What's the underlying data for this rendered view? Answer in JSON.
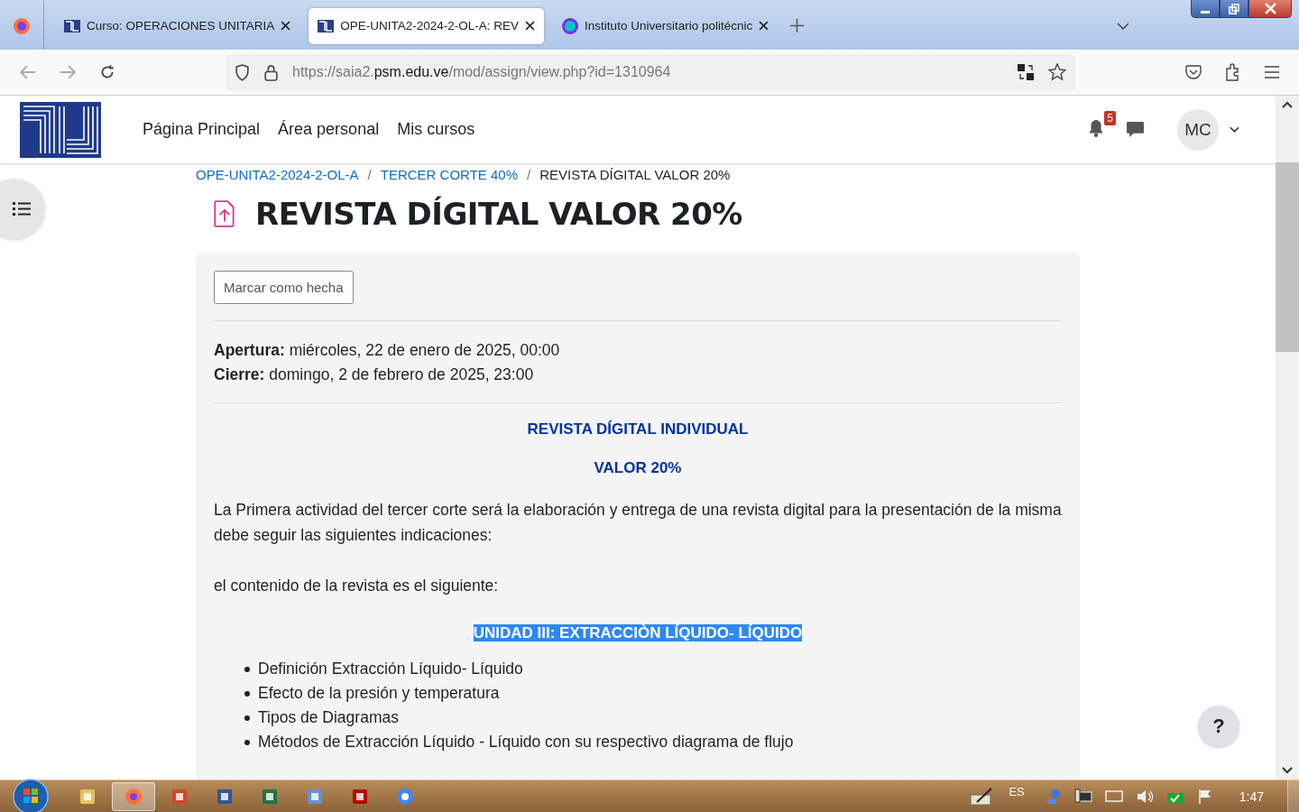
{
  "browser_tabs": [
    {
      "title": "Curso: OPERACIONES UNITARIA",
      "kind": "site",
      "selected": false
    },
    {
      "title": "OPE-UNITA2-2024-2-OL-A: REV",
      "kind": "site",
      "selected": true
    },
    {
      "title": "Instituto Universitario politécnic",
      "kind": "canva",
      "selected": false
    }
  ],
  "address": {
    "prefix": "https://saia2.",
    "host": "psm.edu.ve",
    "path": "/mod/assign/view.php?id=1310964"
  },
  "nav_links": [
    "Página Principal",
    "Área personal",
    "Mis cursos"
  ],
  "notifications": "5",
  "avatar": "MC",
  "breadcrumb": [
    {
      "kind": "link",
      "text": "OPE-UNITA2-2024-2-OL-A"
    },
    {
      "kind": "separator",
      "text": "/"
    },
    {
      "kind": "link",
      "text": "TERCER CORTE 40%"
    },
    {
      "kind": "separator",
      "text": "/"
    },
    {
      "kind": "current",
      "text": "REVISTA DÍGITAL VALOR 20%"
    }
  ],
  "title": "REVISTA DÍGITAL VALOR 20%",
  "done_button": "Marcar como hecha",
  "dates": [
    {
      "label": "Apertura:",
      "value": "miércoles, 22 de enero de 2025, 00:00"
    },
    {
      "label": "Cierre:",
      "value": "domingo, 2 de febrero de 2025, 23:00"
    }
  ],
  "content": [
    {
      "kind": "heading",
      "text": "REVISTA DÍGITAL INDIVIDUAL"
    },
    {
      "kind": "heading",
      "text": "VALOR 20%"
    },
    {
      "kind": "paragraph",
      "text": "La Primera actividad del tercer corte será la elaboración y entrega de una revista digital para la presentación de la misma debe seguir las siguientes indicaciones:"
    },
    {
      "kind": "paragraph",
      "text": "el contenido de la revista es el siguiente:"
    },
    {
      "kind": "highlight",
      "text": "UNIDAD III: EXTRACCIÒN LÍQUIDO- LÍQUIDO"
    },
    {
      "kind": "list",
      "items": [
        "Definición Extracción Líquido- Líquido",
        "Efecto de la presión y temperatura",
        "Tipos de Diagramas",
        "Métodos de Extracción Líquido - Líquido con su respectivo diagrama de flujo"
      ]
    }
  ],
  "help_button": "?",
  "taskbar_apps": [
    {
      "kind": "folder",
      "selected": false
    },
    {
      "kind": "firefox",
      "selected": true
    },
    {
      "kind": "powerpoint",
      "selected": false
    },
    {
      "kind": "word",
      "selected": false
    },
    {
      "kind": "excel",
      "selected": false
    },
    {
      "kind": "scanner",
      "selected": false
    },
    {
      "kind": "pdf",
      "selected": false
    },
    {
      "kind": "chrome",
      "selected": false
    }
  ],
  "language": "ES",
  "clock": "1:47"
}
